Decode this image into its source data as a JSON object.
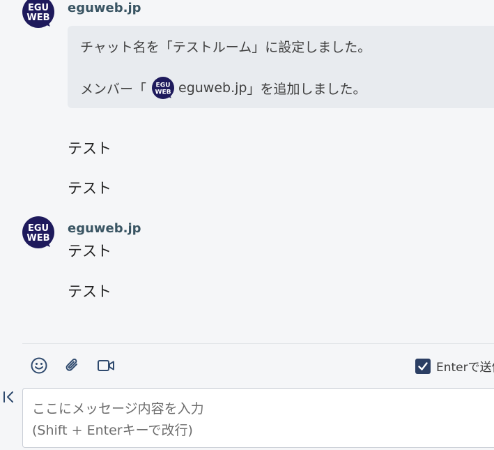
{
  "messages": [
    {
      "sender": "eguweb.jp",
      "system_lines": {
        "line1": "チャット名を「テストルーム」に設定しました。",
        "line2_prefix": "メンバー「",
        "line2_member": "eguweb.jp",
        "line2_suffix": "」を追加しました。"
      },
      "texts": [
        "テスト",
        "テスト"
      ]
    },
    {
      "sender": "eguweb.jp",
      "texts": [
        "テスト",
        "テスト"
      ]
    }
  ],
  "composer": {
    "toolbar_icons": [
      "emoji-icon",
      "attachment-icon",
      "video-icon"
    ],
    "enter_to_send_label": "Enterで送信",
    "enter_to_send_checked": true,
    "placeholder_line1": "ここにメッセージ内容を入力",
    "placeholder_line2": "(Shift + Enterキーで改行)"
  },
  "colors": {
    "avatar_bg": "#1e1a5c",
    "sender": "#3a5563",
    "checkbox": "#2b3e63"
  }
}
